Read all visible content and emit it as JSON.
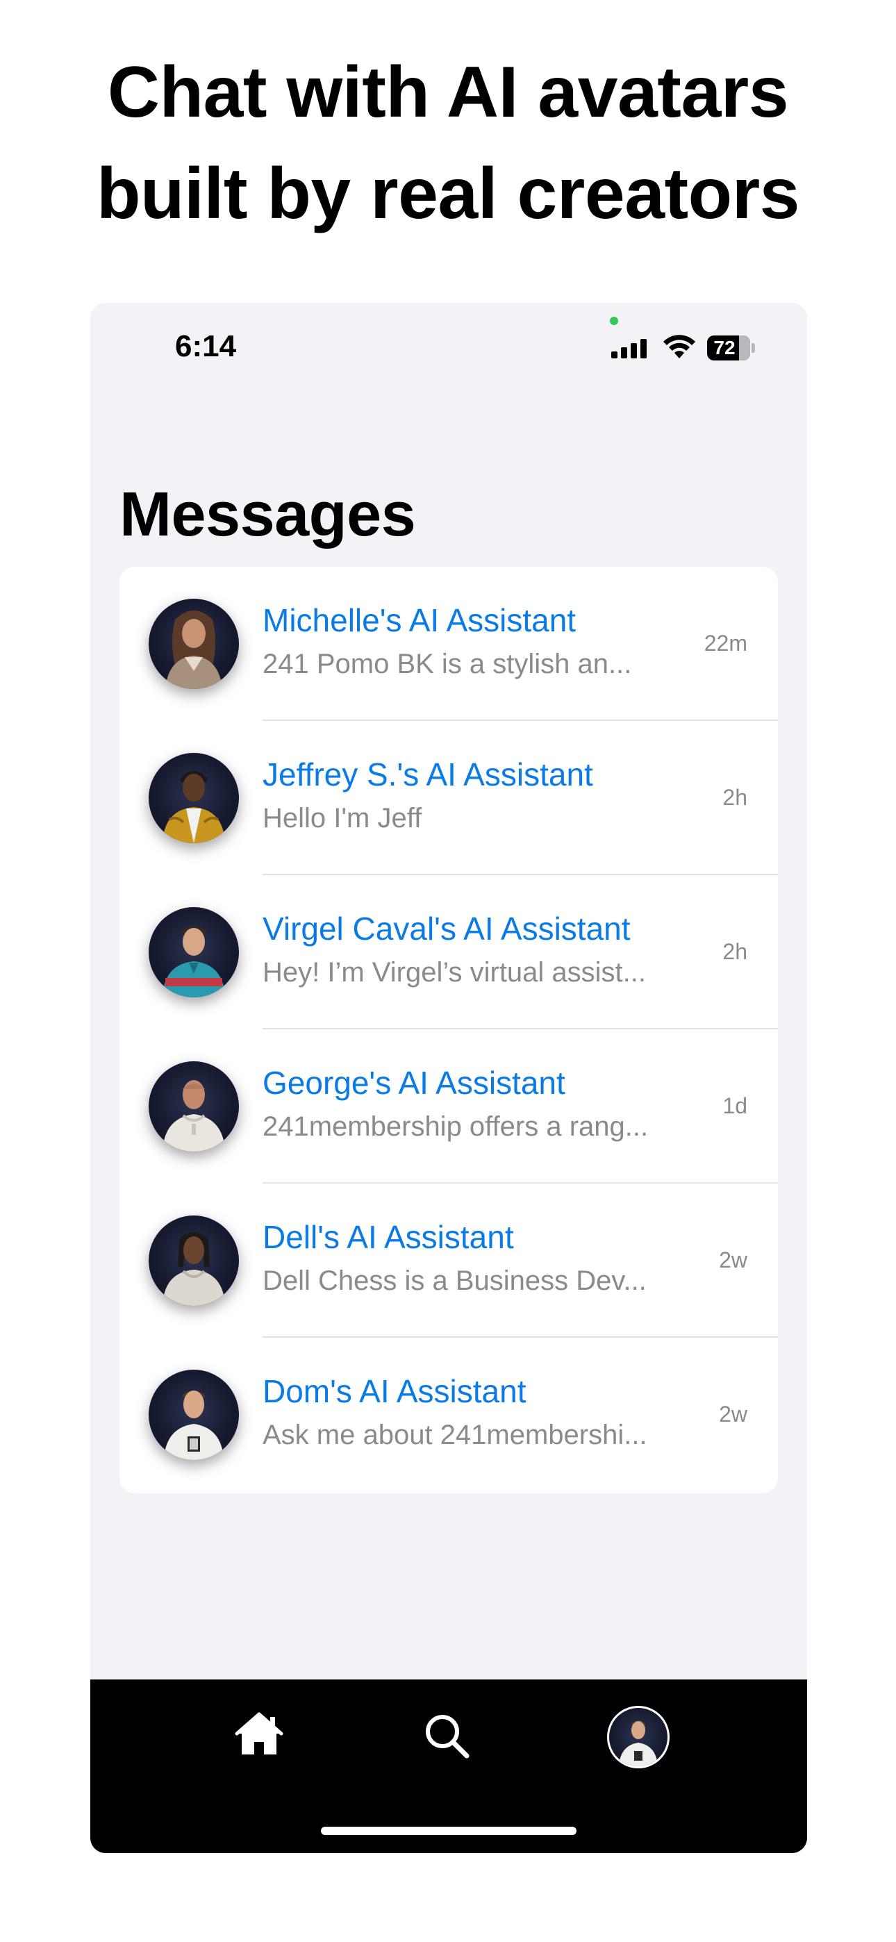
{
  "headline": {
    "line1": "Chat with AI avatars",
    "line2": "built by real creators"
  },
  "status_bar": {
    "time": "6:14",
    "battery_text": "72",
    "battery_level_percent": 72
  },
  "page_title": "Messages",
  "conversations": [
    {
      "name": "Michelle's AI Assistant",
      "preview": "241 Pomo BK is a stylish an...",
      "time": "22m",
      "avatar": "avatar-michelle"
    },
    {
      "name": "Jeffrey S.'s AI Assistant",
      "preview": "Hello I'm Jeff",
      "time": "2h",
      "avatar": "avatar-jeffrey"
    },
    {
      "name": "Virgel Caval's AI Assistant",
      "preview": "Hey! I’m Virgel’s virtual assist...",
      "time": "2h",
      "avatar": "avatar-virgel"
    },
    {
      "name": "George's AI Assistant",
      "preview": "241membership offers a rang...",
      "time": "1d",
      "avatar": "avatar-george"
    },
    {
      "name": "Dell's AI Assistant",
      "preview": "Dell Chess is a Business Dev...",
      "time": "2w",
      "avatar": "avatar-dell"
    },
    {
      "name": "Dom's AI Assistant",
      "preview": "Ask me about 241membershi...",
      "time": "2w",
      "avatar": "avatar-dom"
    }
  ],
  "tab_bar": {
    "items": [
      {
        "icon": "home-icon"
      },
      {
        "icon": "search-icon"
      },
      {
        "icon": "profile-avatar"
      }
    ]
  },
  "colors": {
    "accent": "#0a7ae6",
    "background": "#f2f2f7",
    "tab_bar": "#000000",
    "secondary_text": "#8a8a8e"
  }
}
